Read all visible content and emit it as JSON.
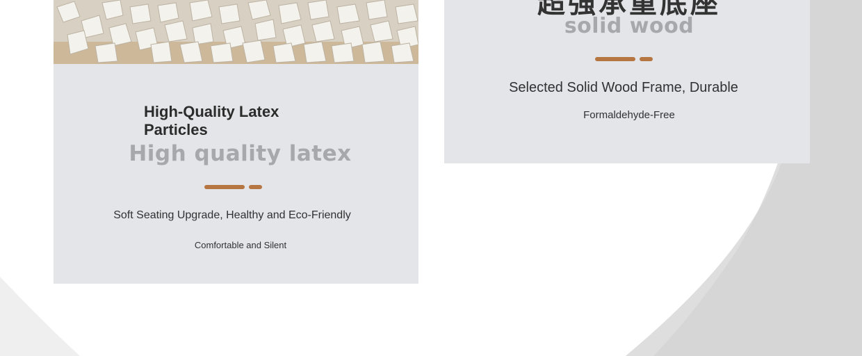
{
  "latex_card": {
    "title_line1": "High-Quality Latex",
    "title_line2": "Particles",
    "english_title": "High quality latex",
    "subtitle": "Soft Seating Upgrade, Healthy and Eco-Friendly",
    "detail": "Comfortable and Silent",
    "image_icon": "latex-particles-photo"
  },
  "wood_card": {
    "chinese_title": "超强承重底座",
    "english_title": "solid wood",
    "subtitle": "Selected Solid Wood Frame, Durable",
    "detail": "Formaldehyde-Free"
  },
  "colors": {
    "card_background": "#e4e5e8",
    "accent_dash": "#b57642",
    "heading_text": "#2b2b2b",
    "watermark_text": "#a7a8ab",
    "background_arc": "#d9d9d9"
  }
}
